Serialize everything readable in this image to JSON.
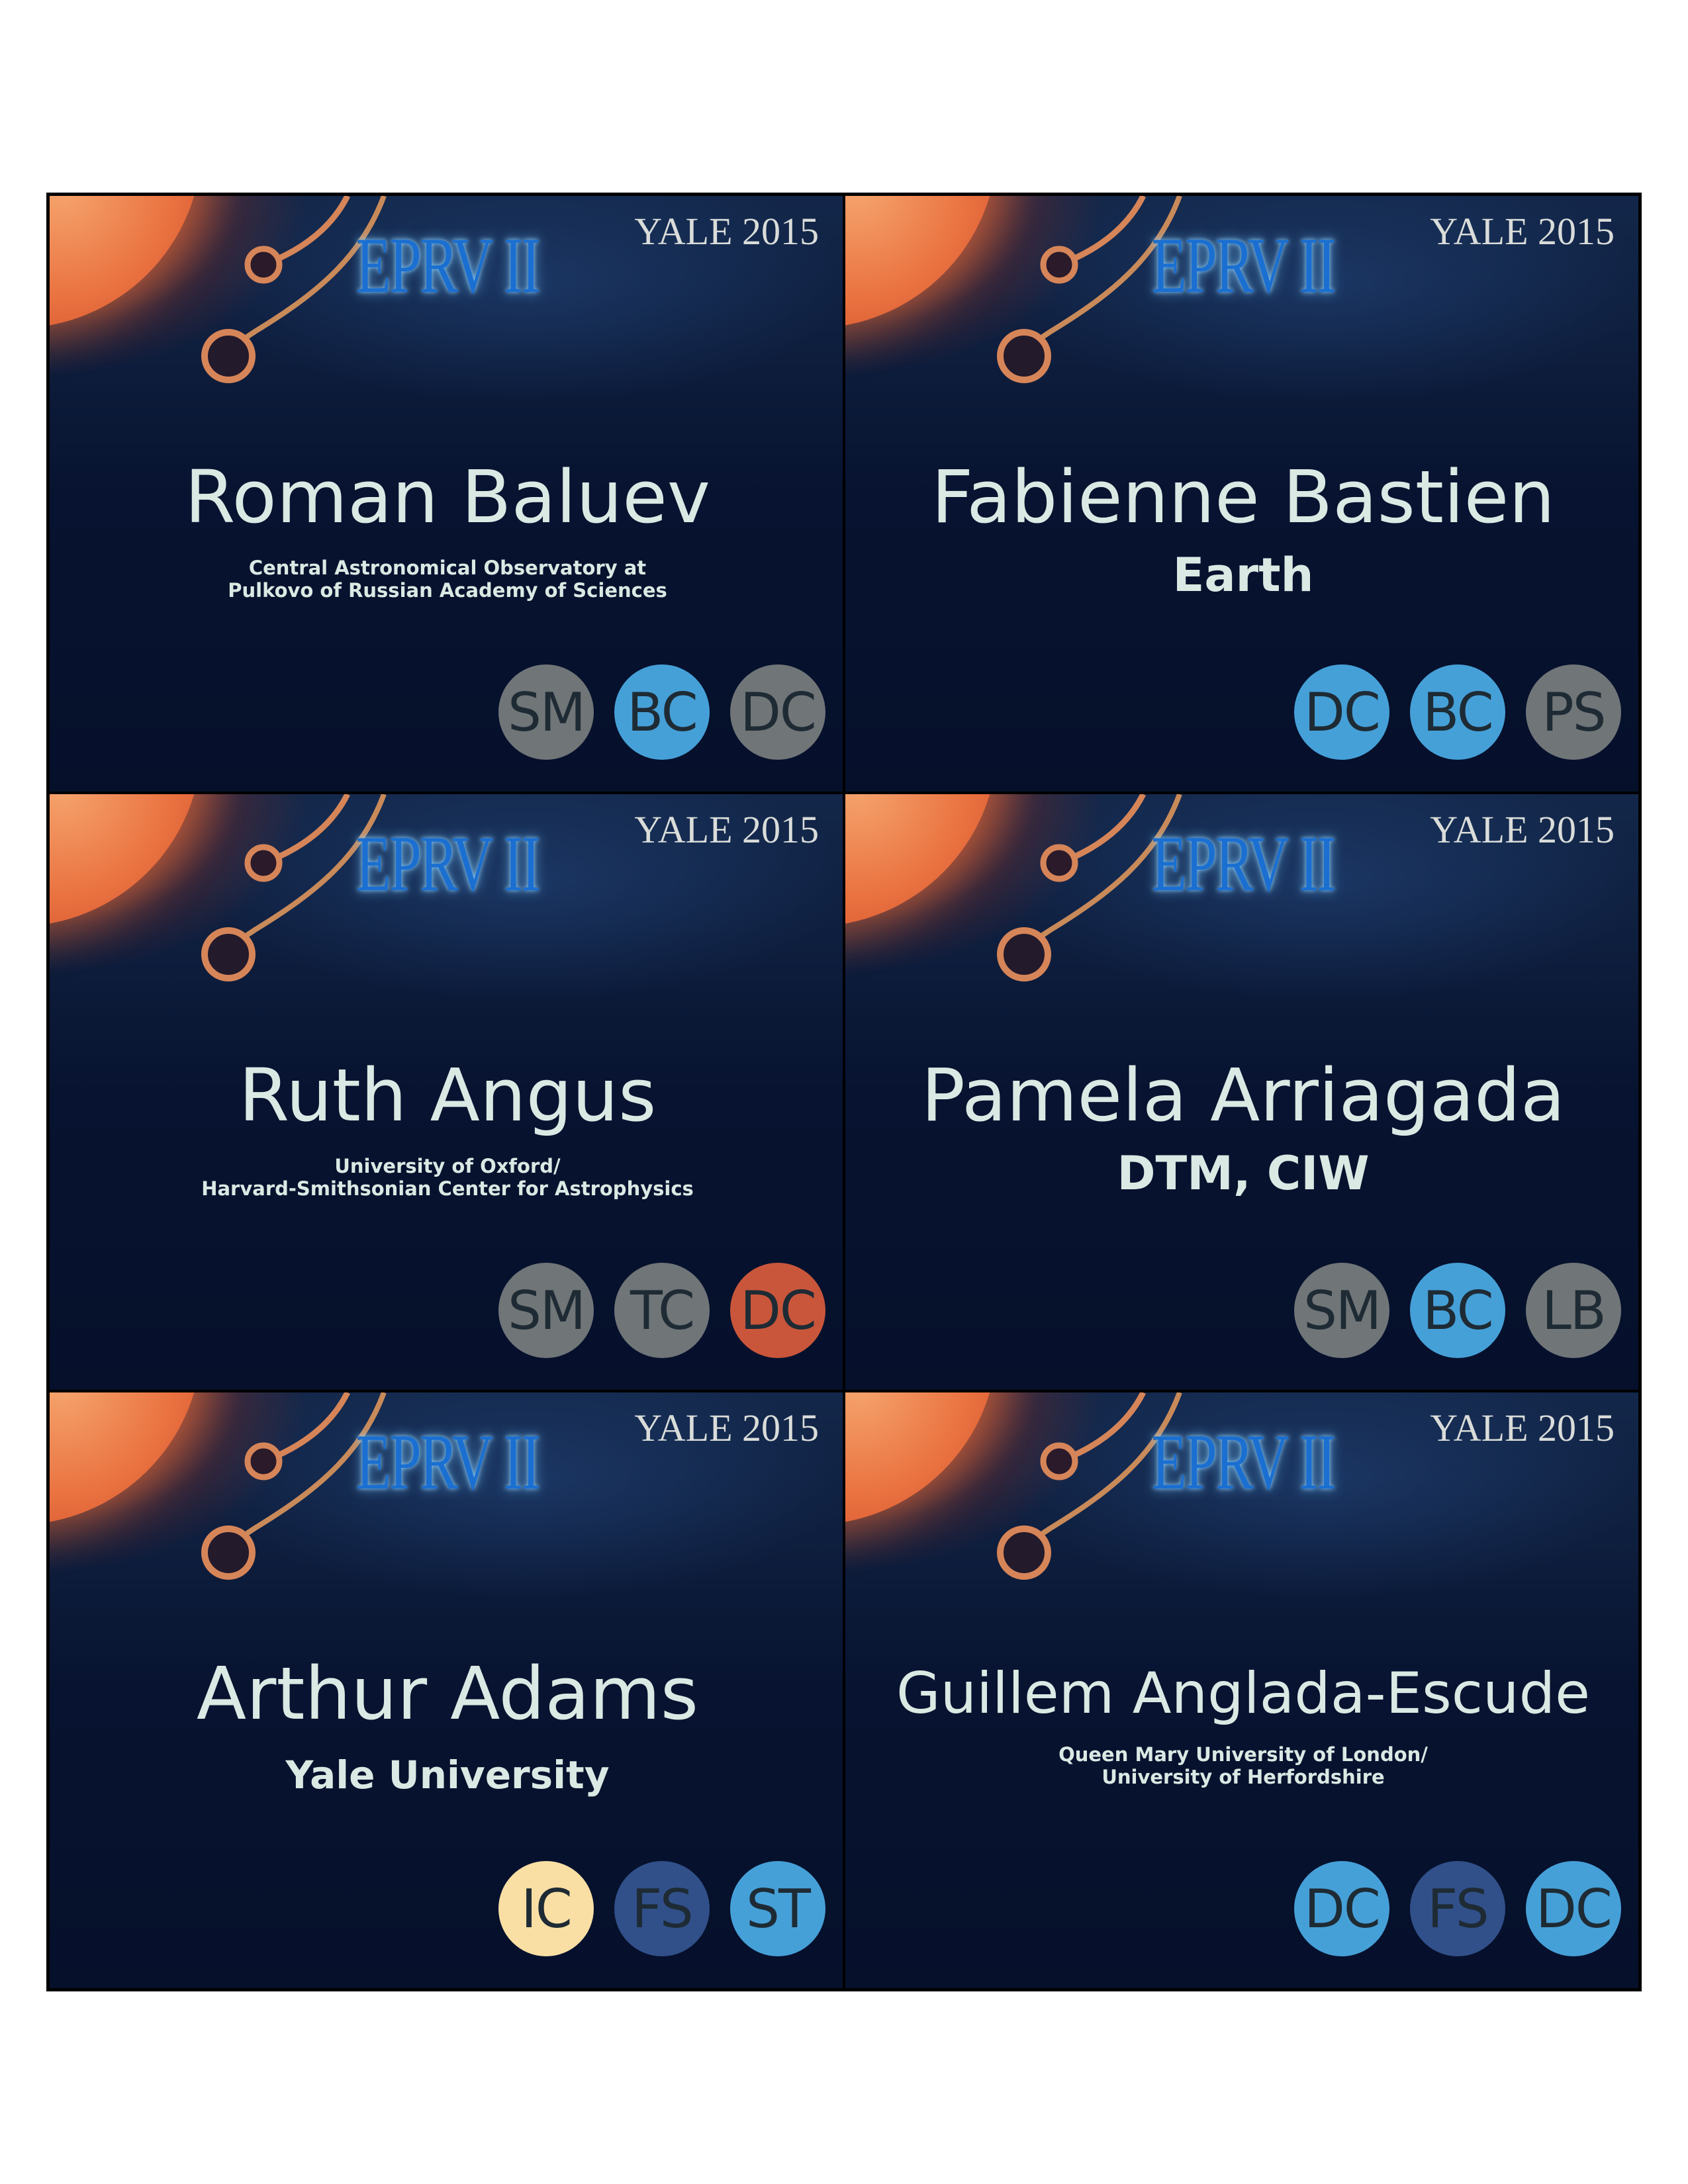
{
  "tag_colors": {
    "SM": "#707578",
    "TC": "#707578",
    "LB": "#707578",
    "PS": "#707578",
    "BC": "#46a0d8",
    "DC_blue": "#46a0d8",
    "ST": "#46a0d8",
    "DC_grey": "#707578",
    "DC_red": "#c9563b",
    "FS": "#31508a",
    "IC": "#f9dfa4"
  },
  "badges": [
    {
      "logo": "EPRV II",
      "event": "YALE 2015",
      "name": "Roman Baluev",
      "name_size": "large",
      "affiliation_lines": [
        "Central Astronomical Observatory at",
        "Pulkovo of Russian Academy of Sciences"
      ],
      "affiliation_size": "small",
      "tags": [
        {
          "label": "SM",
          "color": "#707578"
        },
        {
          "label": "BC",
          "color": "#46a0d8"
        },
        {
          "label": "DC",
          "color": "#707578"
        }
      ]
    },
    {
      "logo": "EPRV II",
      "event": "YALE 2015",
      "name": "Fabienne Bastien",
      "name_size": "large",
      "affiliation_lines": [
        "Earth"
      ],
      "affiliation_size": "big",
      "tags": [
        {
          "label": "DC",
          "color": "#46a0d8"
        },
        {
          "label": "BC",
          "color": "#46a0d8"
        },
        {
          "label": "PS",
          "color": "#707578"
        }
      ]
    },
    {
      "logo": "EPRV II",
      "event": "YALE 2015",
      "name": "Ruth Angus",
      "name_size": "large",
      "affiliation_lines": [
        "University of Oxford/",
        "Harvard-Smithsonian Center for Astrophysics"
      ],
      "affiliation_size": "small",
      "tags": [
        {
          "label": "SM",
          "color": "#707578"
        },
        {
          "label": "TC",
          "color": "#707578"
        },
        {
          "label": "DC",
          "color": "#c9563b"
        }
      ]
    },
    {
      "logo": "EPRV II",
      "event": "YALE 2015",
      "name": "Pamela Arriagada",
      "name_size": "large",
      "affiliation_lines": [
        "DTM, CIW"
      ],
      "affiliation_size": "big",
      "tags": [
        {
          "label": "SM",
          "color": "#707578"
        },
        {
          "label": "BC",
          "color": "#46a0d8"
        },
        {
          "label": "LB",
          "color": "#707578"
        }
      ]
    },
    {
      "logo": "EPRV II",
      "event": "YALE 2015",
      "name": "Arthur Adams",
      "name_size": "large",
      "affiliation_lines": [
        "Yale University"
      ],
      "affiliation_size": "mid",
      "tags": [
        {
          "label": "IC",
          "color": "#f9dfa4"
        },
        {
          "label": "FS",
          "color": "#31508a"
        },
        {
          "label": "ST",
          "color": "#46a0d8"
        }
      ]
    },
    {
      "logo": "EPRV II",
      "event": "YALE 2015",
      "name": "Guillem Anglada-Escude",
      "name_size": "medium",
      "affiliation_lines": [
        "Queen Mary University of London/",
        "University of Herfordshire"
      ],
      "affiliation_size": "small",
      "tags": [
        {
          "label": "DC",
          "color": "#46a0d8"
        },
        {
          "label": "FS",
          "color": "#31508a"
        },
        {
          "label": "DC",
          "color": "#46a0d8"
        }
      ]
    }
  ]
}
